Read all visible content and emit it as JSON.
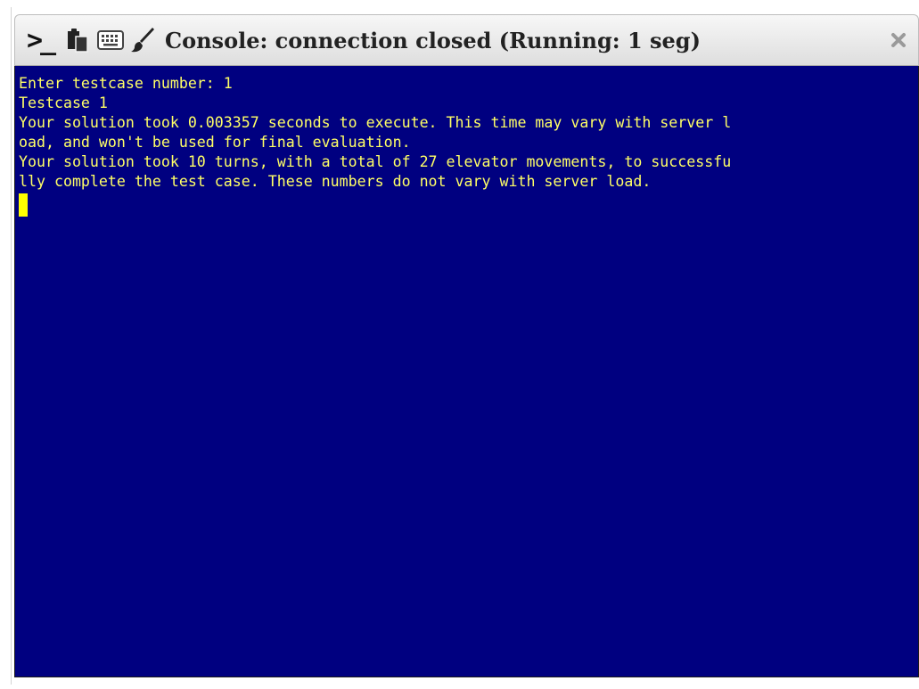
{
  "window": {
    "title": "Console: connection closed (Running: 1 seg)",
    "prompt_symbol": ">_",
    "icons": [
      "prompt-icon",
      "clipboard-icon",
      "keyboard-icon",
      "paintbrush-icon"
    ],
    "close_label": "×"
  },
  "terminal": {
    "lines": [
      "Enter testcase number: 1",
      "Testcase 1",
      "Your solution took 0.003357 seconds to execute. This time may vary with server l",
      "oad, and won't be used for final evaluation.",
      "Your solution took 10 turns, with a total of 27 elevator movements, to successfu",
      "lly complete the test case. These numbers do not vary with server load."
    ],
    "background_color": "#000080",
    "text_color": "#ffff66",
    "cursor_color": "#ffff00"
  }
}
